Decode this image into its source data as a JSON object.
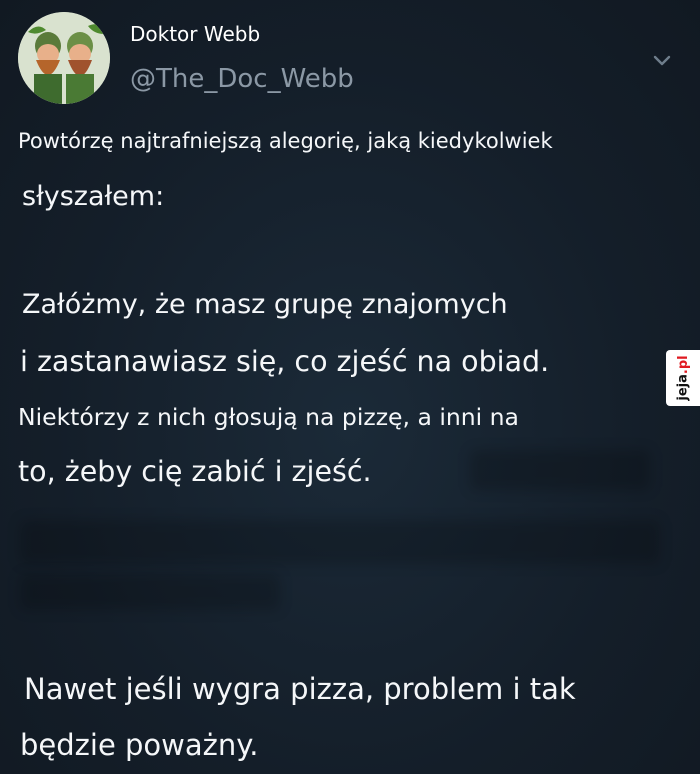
{
  "author": {
    "display_name": "Doktor Webb",
    "handle": "@The_Doc_Webb",
    "avatar_icon": "avatar-image-icon"
  },
  "menu_icon": "chevron-down-icon",
  "tweet": {
    "lines": [
      "Powtórzę najtrafniejszą alegorię, jaką kiedykolwiek",
      "słyszałem:",
      "Załóżmy, że masz grupę znajomych",
      "i zastanawiasz się, co zjeść na obiad.",
      "Niektórzy z nich głosują na pizzę, a inni na",
      "to, żeby cię zabić i zjeść.",
      "Nawet jeśli wygra pizza, problem i tak",
      "będzie poważny."
    ]
  },
  "watermark": {
    "text": "jeja.pl"
  },
  "colors": {
    "background": "#15202b",
    "text": "#f5f7f9",
    "secondary": "#8b98a5",
    "watermark_red": "#e01b22"
  }
}
